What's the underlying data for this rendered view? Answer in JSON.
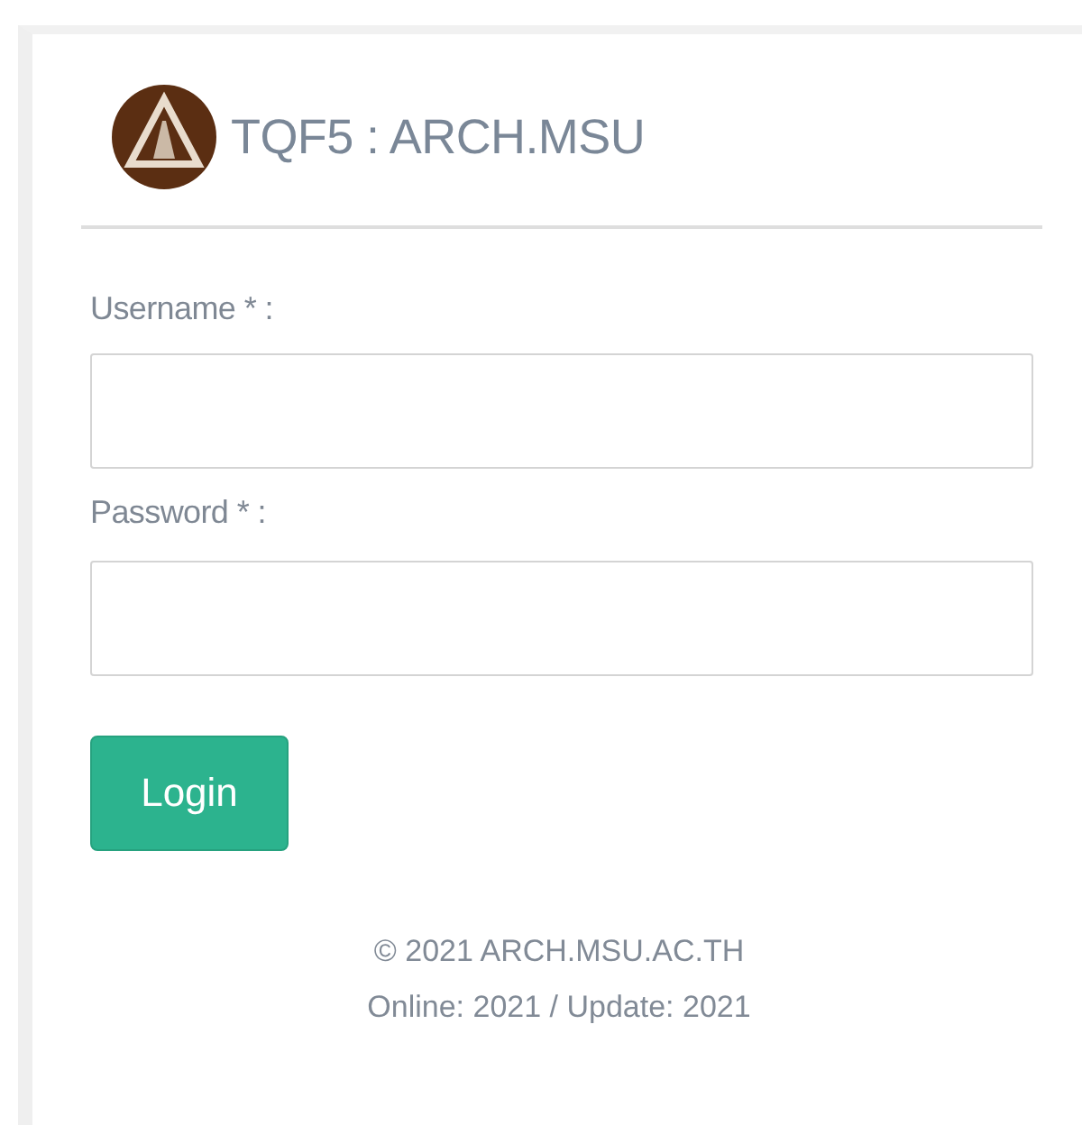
{
  "title": "TQF5 : ARCH.MSU",
  "fields": [
    {
      "label": "Username * :"
    },
    {
      "label": "Password * :"
    }
  ],
  "button": "Login",
  "footer": [
    "© 2021 ARCH.MSU.AC.TH",
    "Online: 2021 / Update: 2021"
  ]
}
